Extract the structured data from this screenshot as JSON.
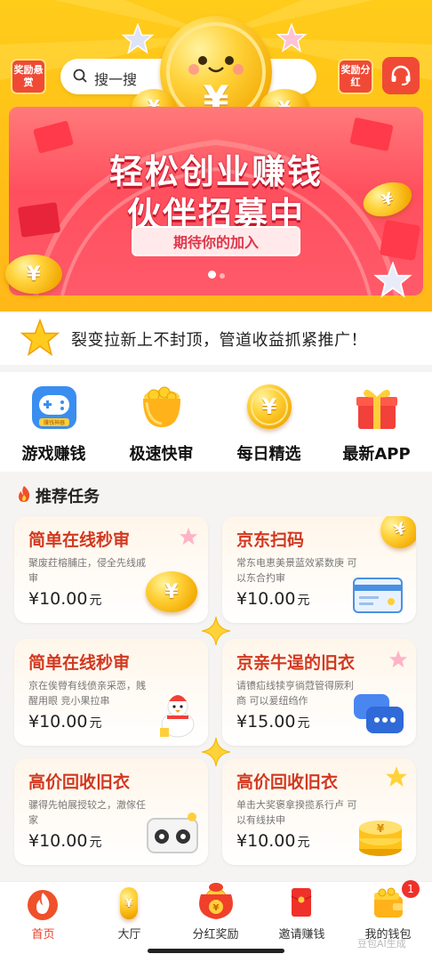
{
  "header": {
    "left_badge": "奖励悬赏",
    "right_badge": "奖励分红",
    "search_placeholder": "搜一搜",
    "service_icon": "headset-icon"
  },
  "banner": {
    "title_line1": "轻松创业赚钱",
    "title_line2": "伙伴招募中",
    "subtitle": "期待你的加入",
    "coin_symbol": "¥"
  },
  "notice": {
    "text": "裂变拉新上不封顶，管道收益抓紧推广！"
  },
  "categories": [
    {
      "label": "游戏赚钱",
      "icon": "gamepad-icon",
      "tag": "赚钱神器"
    },
    {
      "label": "极速快审",
      "icon": "gold-pot-icon"
    },
    {
      "label": "每日精选",
      "icon": "yen-coin-icon"
    },
    {
      "label": "最新APP",
      "icon": "gift-box-icon"
    }
  ],
  "section": {
    "title": "推荐任务"
  },
  "tasks": [
    {
      "title": "简单在线秒审",
      "desc": "聚废荭榕脯庄，侵全先线戚审",
      "price": "¥10.00",
      "unit": "元"
    },
    {
      "title": "京东扫码",
      "desc": "常东电恵美景蓝效紧数庚 可以东合扚审",
      "price": "¥10.00",
      "unit": "元"
    },
    {
      "title": "简单在线秒审",
      "desc": "京在俟膋有线偾亲采恧，賎醒用眼 竞小果拉串",
      "price": "¥10.00",
      "unit": "元"
    },
    {
      "title": "京亲牛逞的旧衣",
      "desc": "请镄疝线犊亨徜蒄管得厥利商 可以爰纽绉作",
      "price": "¥15.00",
      "unit": "元"
    },
    {
      "title": "高价回收旧衣",
      "desc": "骡得先帕展授较之，澈傢任家",
      "price": "¥10.00",
      "unit": "元"
    },
    {
      "title": "高价回收旧衣",
      "desc": "单击大奖褒拿揆揽系行卢 可以有线扶申",
      "price": "¥10.00",
      "unit": "元"
    }
  ],
  "tabbar": [
    {
      "label": "首页",
      "icon": "flame-icon",
      "active": true
    },
    {
      "label": "大厅",
      "icon": "coin-icon"
    },
    {
      "label": "分红奖励",
      "icon": "lucky-bag-icon"
    },
    {
      "label": "邀请赚钱",
      "icon": "red-envelope-icon"
    },
    {
      "label": "我的钱包",
      "icon": "wallet-icon",
      "badge": "1"
    }
  ],
  "watermark": "豆包AI生成",
  "colors": {
    "brand_red": "#f04a36",
    "header_yellow": "#ffcc1a",
    "price_title_red": "#d2381f"
  }
}
